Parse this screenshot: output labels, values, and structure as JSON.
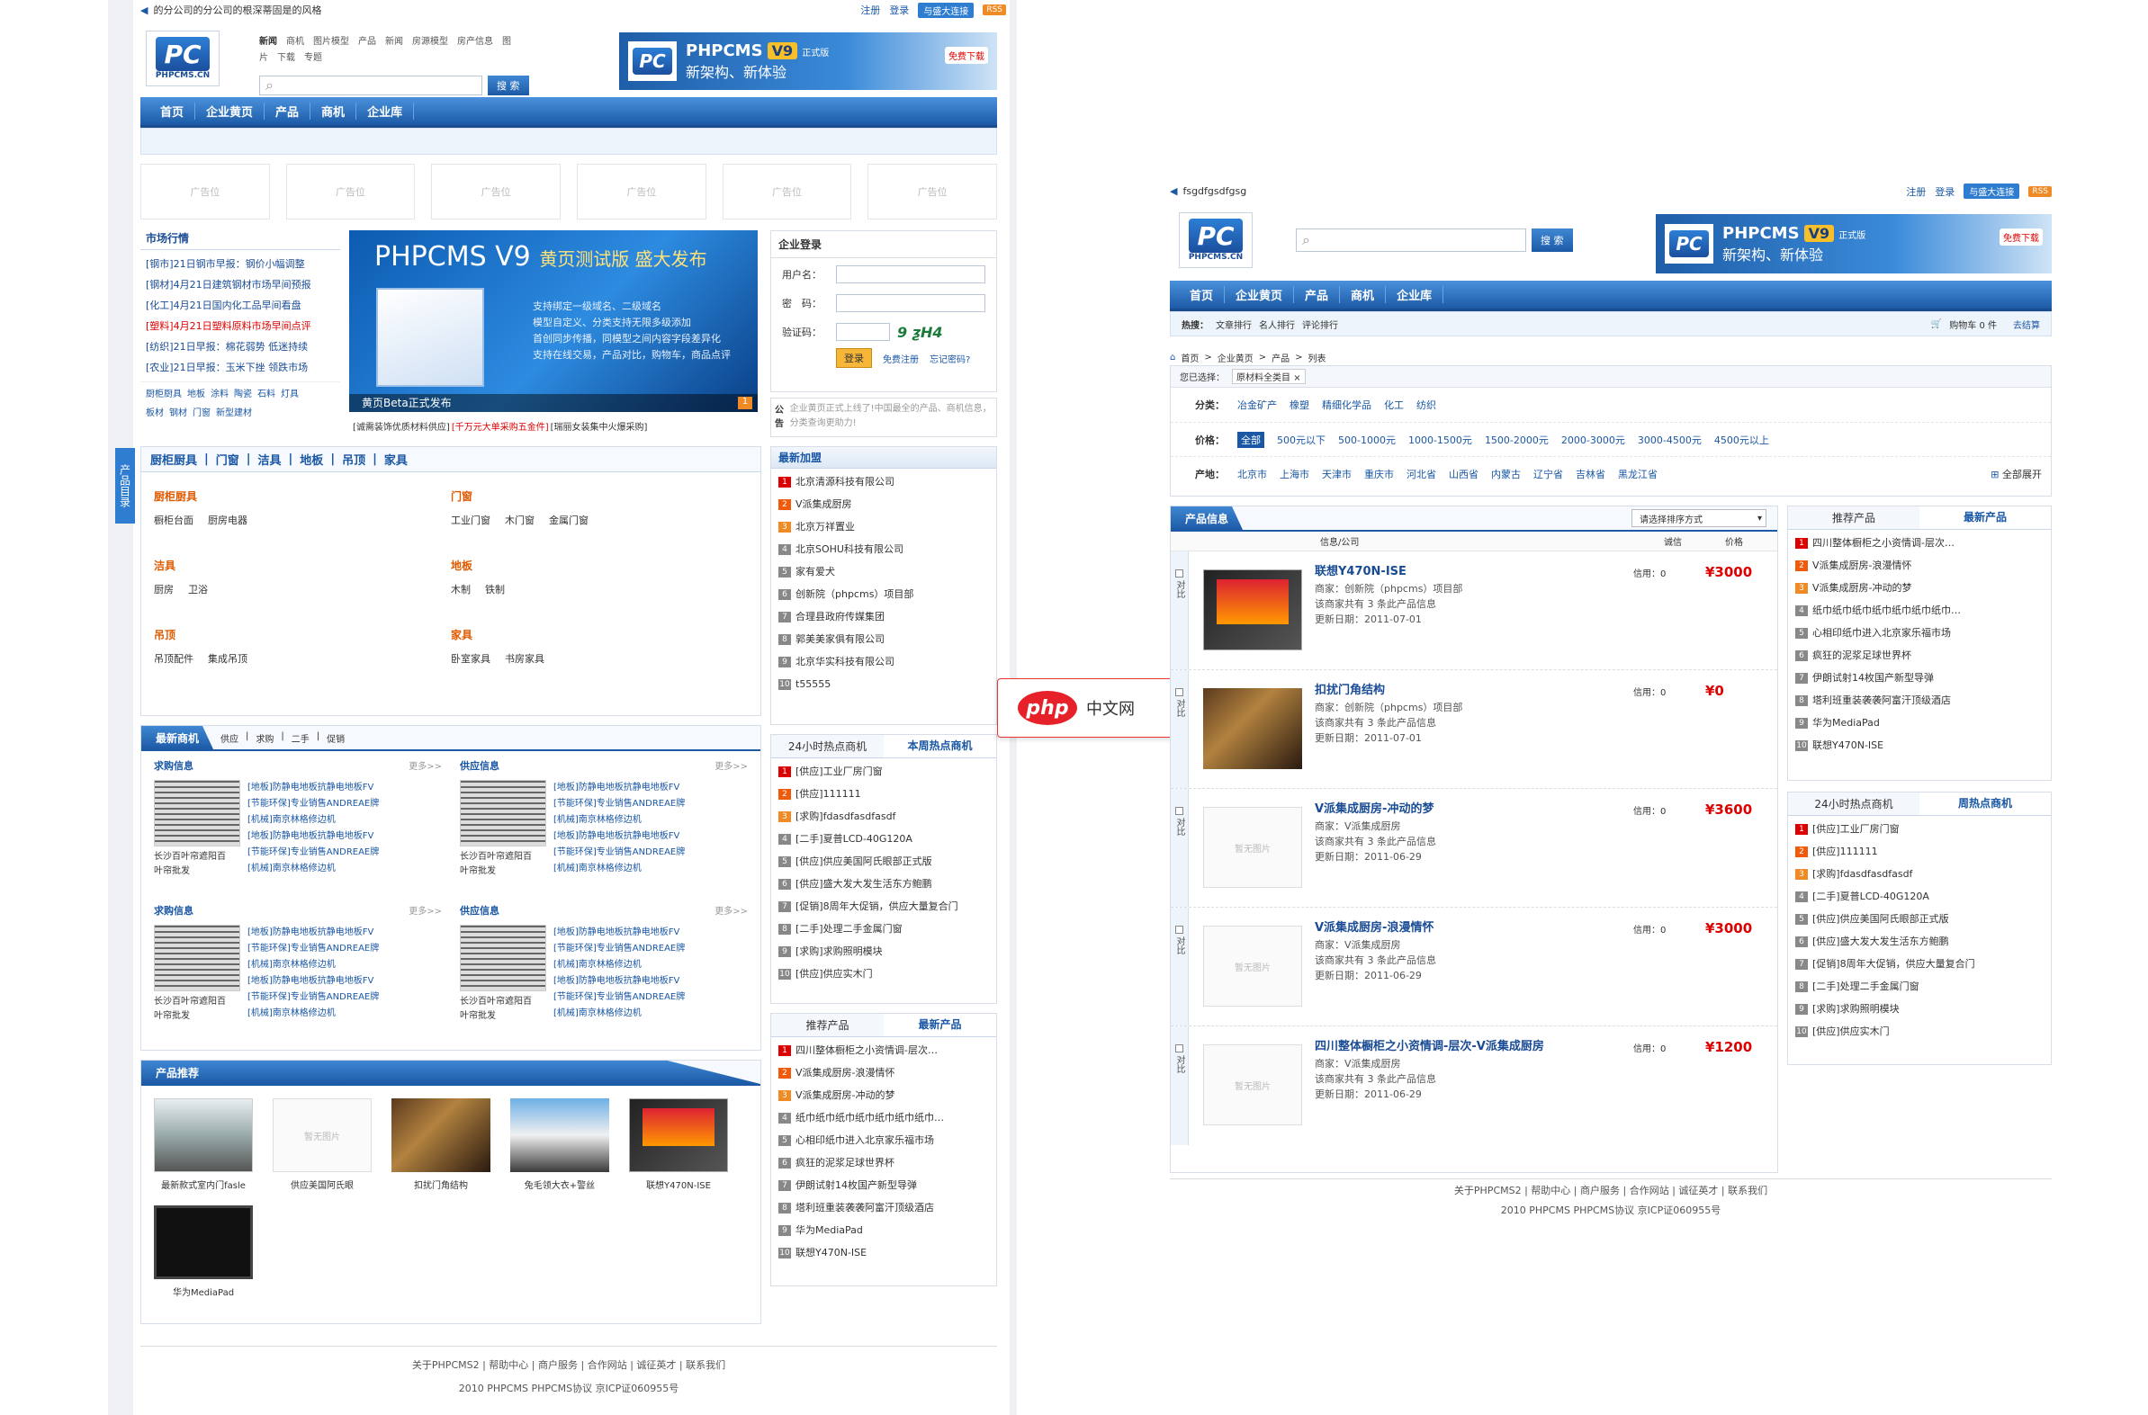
{
  "left": {
    "topbar": {
      "slogan": "的分公司的分公司的根深蒂固是的风格",
      "register": "注册",
      "login": "登录",
      "qiye": "与盛大连接",
      "rss": "RSS"
    },
    "logo": {
      "mark": "PC",
      "text": "PHPCMS.CN"
    },
    "header_links": {
      "row1": [
        "新闻",
        "商机",
        "图片模型",
        "产品",
        "新闻",
        "房源模型",
        "房产信息",
        "图"
      ],
      "row2": [
        "片",
        "下载",
        "专题"
      ]
    },
    "search": {
      "button": "搜 索"
    },
    "banner": {
      "title": "PHPCMS",
      "v9": "V9",
      "tag": "正式版",
      "slogan": "新架构、新体验",
      "download": "免费下载"
    },
    "nav": [
      "首页",
      "企业黄页",
      "产品",
      "商机",
      "企业库"
    ],
    "ads": [
      "广告位",
      "广告位",
      "广告位",
      "广告位",
      "广告位",
      "广告位"
    ],
    "market": {
      "title": "市场行情",
      "items": [
        "[钢市]21日钢市早报：钢价小幅调整",
        "[钢材]4月21日建筑钢材市场早间预报",
        "[化工]4月21日国内化工品早间看盘",
        "[塑料]4月21日塑料原料市场早间点评",
        "[纺织]21日早报：棉花弱势 低迷持续",
        "[农业]21日早报：玉米下挫 领跌市场"
      ],
      "tags1": [
        "厨柜厨具",
        "地板",
        "涂料",
        "陶瓷",
        "石料",
        "灯具"
      ],
      "tags2": [
        "板材",
        "钢材",
        "门窗",
        "新型建材"
      ]
    },
    "hero": {
      "title": "PHPCMS V9",
      "subtitle": "黄页测试版 盛大发布",
      "desc": [
        "支持绑定一级域名、二级域名",
        "模型自定义、分类支持无限多级添加",
        "首创同步传播，同模型之间内容字段差异化",
        "支持在线交易，产品对比，购物车，商品点评"
      ],
      "caption": "黄页Beta正式发布",
      "page": "1",
      "ticker": [
        "[诚需装饰优质材料供应]",
        "[千万元大单采购五金件]",
        "[瑞丽女装集中火爆采购]"
      ]
    },
    "login": {
      "title": "企业登录",
      "user": "用户名：",
      "pwd": "密　码：",
      "code": "验证码：",
      "captcha": "9 ƺH4",
      "btn": "登录",
      "reg": "免费注册",
      "forgot": "忘记密码?",
      "notice_label": "公告",
      "notice": "企业黄页正式上线了!中国最全的产品、商机信息，分类查询更助力!"
    },
    "latest": {
      "title": "最新加盟",
      "items": [
        "北京清源科技有限公司",
        "V派集成厨房",
        "北京万祥置业",
        "北京SOHU科技有限公司",
        "家有爱犬",
        "创新院（phpcms）项目部",
        "合理县政府传媒集团",
        "郭美美家俱有限公司",
        "北京华实科技有限公司",
        "t55555"
      ]
    },
    "catalog": {
      "side": "产品目录",
      "tabs": [
        "厨柜厨具",
        "门窗",
        "洁具",
        "地板",
        "吊顶",
        "家具"
      ],
      "blocks": [
        {
          "h": "厨柜厨具",
          "items": [
            "橱柜台面",
            "厨房电器"
          ]
        },
        {
          "h": "门窗",
          "items": [
            "工业门窗",
            "木门窗",
            "金属门窗"
          ]
        },
        {
          "h": "洁具",
          "items": [
            "厨房",
            "卫浴"
          ]
        },
        {
          "h": "地板",
          "items": [
            "木制",
            "铁制"
          ]
        },
        {
          "h": "吊顶",
          "items": [
            "吊顶配件",
            "集成吊顶"
          ]
        },
        {
          "h": "家具",
          "items": [
            "卧室家具",
            "书房家具"
          ]
        }
      ]
    },
    "biz": {
      "title": "最新商机",
      "tabs": [
        "供应",
        "求购",
        "二手",
        "促销"
      ],
      "groups": [
        {
          "h": "求购信息",
          "more": "更多>>"
        },
        {
          "h": "供应信息",
          "more": "更多>>"
        },
        {
          "h": "求购信息",
          "more": "更多>>"
        },
        {
          "h": "供应信息",
          "more": "更多>>"
        }
      ],
      "caption1": "长沙百叶帘遮阳百",
      "caption2": "叶帘批发",
      "lines": [
        "[地板]防静电地板抗静电地板FV",
        "[节能环保]专业销售ANDREAE牌",
        "[机械]南京林格修边机",
        "[地板]防静电地板抗静电地板FV",
        "[节能环保]专业销售ANDREAE牌",
        "[机械]南京林格修边机"
      ]
    },
    "hot": {
      "tabs": [
        "24小时热点商机",
        "本周热点商机"
      ],
      "items": [
        "[供应]工业厂房门窗",
        "[供应]111111",
        "[求购]fdasdfasdfasdf",
        "[二手]夏普LCD-40G120A",
        "[供应]供应美国阿氏眼部正式版",
        "[供应]盛大发大发生活东方鲍鹏",
        "[促销]8周年大促销，供应大量复合门",
        "[二手]处理二手金属门窗",
        "[求购]求购照明模块",
        "[供应]供应实木门"
      ]
    },
    "prod_rec": {
      "title": "产品推荐",
      "nopic": "暂无图片",
      "items": [
        "最新款式室内门fasle",
        "供应美国阿氏眼",
        "扣扰门角结构",
        "兔毛领大衣+警丝",
        "联想Y470N-ISE",
        "华为MediaPad"
      ]
    },
    "newprod": {
      "tabs": [
        "推荐产品",
        "最新产品"
      ],
      "items": [
        "四川整体橱柜之小资情调-层次…",
        "V派集成厨房-浪漫情怀",
        "V派集成厨房-冲动的梦",
        "纸巾纸巾纸巾纸巾纸巾纸巾纸巾…",
        "心相印纸巾进入北京家乐福市场",
        "疯狂的泥浆足球世界杯",
        "伊朗试射14枚国产新型导弹",
        "塔利班重装袭袭阿富汗顶级酒店",
        "华为MediaPad",
        "联想Y470N-ISE"
      ]
    },
    "footer": {
      "links": "关于PHPCMS2 | 帮助中心 | 商户服务 | 合作网站 | 诚征英才 | 联系我们",
      "copy": "2010 PHPCMS PHPCMS协议 京ICP证060955号"
    }
  },
  "right": {
    "topbar": {
      "slogan": "fsgdfgsdfgsg",
      "register": "注册",
      "login": "登录",
      "qiye": "与盛大连接",
      "rss": "RSS"
    },
    "search": {
      "button": "搜 索"
    },
    "nav": [
      "首页",
      "企业黄页",
      "产品",
      "商机",
      "企业库"
    ],
    "subnav": {
      "label": "热搜：",
      "links": [
        "文章排行",
        "名人排行",
        "评论排行"
      ],
      "cart": "购物车 0 件",
      "checkout": "去结算"
    },
    "breadcrumb": [
      "首页",
      "企业黄页",
      "产品",
      "列表"
    ],
    "filter": {
      "selected_label": "您已选择：",
      "selected": "原材料全类目",
      "category_label": "分类：",
      "categories": [
        "冶金矿产",
        "橡塑",
        "精细化学品",
        "化工",
        "纺织"
      ],
      "price_label": "价格：",
      "prices": [
        "全部",
        "500元以下",
        "500-1000元",
        "1000-1500元",
        "1500-2000元",
        "2000-3000元",
        "3000-4500元",
        "4500元以上"
      ],
      "area_label": "产地：",
      "areas": [
        "北京市",
        "上海市",
        "天津市",
        "重庆市",
        "河北省",
        "山西省",
        "内蒙古",
        "辽宁省",
        "吉林省",
        "黑龙江省"
      ],
      "expand": "全部展开"
    },
    "list": {
      "title": "产品信息",
      "sort": "请选择排序方式",
      "cols": [
        "信息/公司",
        "诚信",
        "价格"
      ],
      "compare": "对比",
      "nopic": "暂无图片",
      "items": [
        {
          "name": "联想Y470N-ISE",
          "seller": "商家：创新院（phpcms）项目部",
          "count": "该商家共有 3 条此产品信息",
          "date": "更新日期：2011-07-01",
          "credit": "信用：0",
          "price": "¥3000"
        },
        {
          "name": "扣扰门角结构",
          "seller": "商家：创新院（phpcms）项目部",
          "count": "该商家共有 3 条此产品信息",
          "date": "更新日期：2011-07-01",
          "credit": "信用：0",
          "price": "¥0"
        },
        {
          "name": "V派集成厨房-冲动的梦",
          "seller": "商家：V派集成厨房",
          "count": "该商家共有 3 条此产品信息",
          "date": "更新日期：2011-06-29",
          "credit": "信用：0",
          "price": "¥3600"
        },
        {
          "name": "V派集成厨房-浪漫情怀",
          "seller": "商家：V派集成厨房",
          "count": "该商家共有 3 条此产品信息",
          "date": "更新日期：2011-06-29",
          "credit": "信用：0",
          "price": "¥3000"
        },
        {
          "name": "四川整体橱柜之小资情调-层次-V派集成厨房",
          "seller": "商家：V派集成厨房",
          "count": "该商家共有 3 条此产品信息",
          "date": "更新日期：2011-06-29",
          "credit": "信用：0",
          "price": "¥1200"
        }
      ]
    },
    "rec": {
      "tabs": [
        "推荐产品",
        "最新产品"
      ],
      "items": [
        "四川整体橱柜之小资情调-层次…",
        "V派集成厨房-浪漫情怀",
        "V派集成厨房-冲动的梦",
        "纸巾纸巾纸巾纸巾纸巾纸巾纸巾…",
        "心相印纸巾进入北京家乐福市场",
        "疯狂的泥浆足球世界杯",
        "伊朗试射14枚国产新型导弹",
        "塔利班重装袭袭阿富汗顶级酒店",
        "华为MediaPad",
        "联想Y470N-ISE"
      ]
    },
    "hot": {
      "tabs": [
        "24小时热点商机",
        "周热点商机"
      ],
      "items": [
        "[供应]工业厂房门窗",
        "[供应]111111",
        "[求购]fdasdfasdfasdf",
        "[二手]夏普LCD-40G120A",
        "[供应]供应美国阿氏眼部正式版",
        "[供应]盛大发大发生活东方鲍鹏",
        "[促销]8周年大促销，供应大量复合门",
        "[二手]处理二手金属门窗",
        "[求购]求购照明模块",
        "[供应]供应实木门"
      ]
    },
    "footer": {
      "links": "关于PHPCMS2 | 帮助中心 | 商户服务 | 合作网站 | 诚征英才 | 联系我们",
      "copy": "2010 PHPCMS PHPCMS协议 京ICP证060955号"
    }
  },
  "watermark": {
    "logo": "php",
    "text": "中文网"
  }
}
